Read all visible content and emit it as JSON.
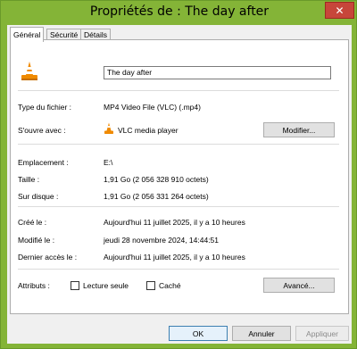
{
  "window": {
    "title": "Propriétés de : The day after",
    "close_glyph": "✕",
    "accent_color": "#84b437"
  },
  "tabs": [
    {
      "label": "Général",
      "active": true
    },
    {
      "label": "Sécurité",
      "active": false
    },
    {
      "label": "Détails",
      "active": false
    }
  ],
  "file": {
    "icon": "vlc-cone-icon",
    "name": "The day after"
  },
  "fields": {
    "type_label": "Type du fichier :",
    "type_value": "MP4 Video File (VLC) (.mp4)",
    "opens_label": "S'ouvre avec :",
    "opens_value": "VLC media player",
    "modify_button": "Modifier...",
    "location_label": "Emplacement :",
    "location_value": "E:\\",
    "size_label": "Taille :",
    "size_value": "1,91 Go (2 056 328 910 octets)",
    "disk_label": "Sur disque :",
    "disk_value": "1,91 Go (2 056 331 264 octets)",
    "created_label": "Créé le :",
    "created_value": "Aujourd'hui 11 juillet 2025, il y a 10 heures",
    "modified_label": "Modifié le :",
    "modified_value": "jeudi 28 novembre 2024, 14:44:51",
    "accessed_label": "Dernier accès le :",
    "accessed_value": "Aujourd'hui 11 juillet 2025, il y a 10 heures",
    "attributes_label": "Attributs :",
    "readonly_label": "Lecture seule",
    "readonly_checked": false,
    "hidden_label": "Caché",
    "hidden_checked": false,
    "advanced_button": "Avancé..."
  },
  "buttons": {
    "ok": "OK",
    "cancel": "Annuler",
    "apply": "Appliquer"
  }
}
